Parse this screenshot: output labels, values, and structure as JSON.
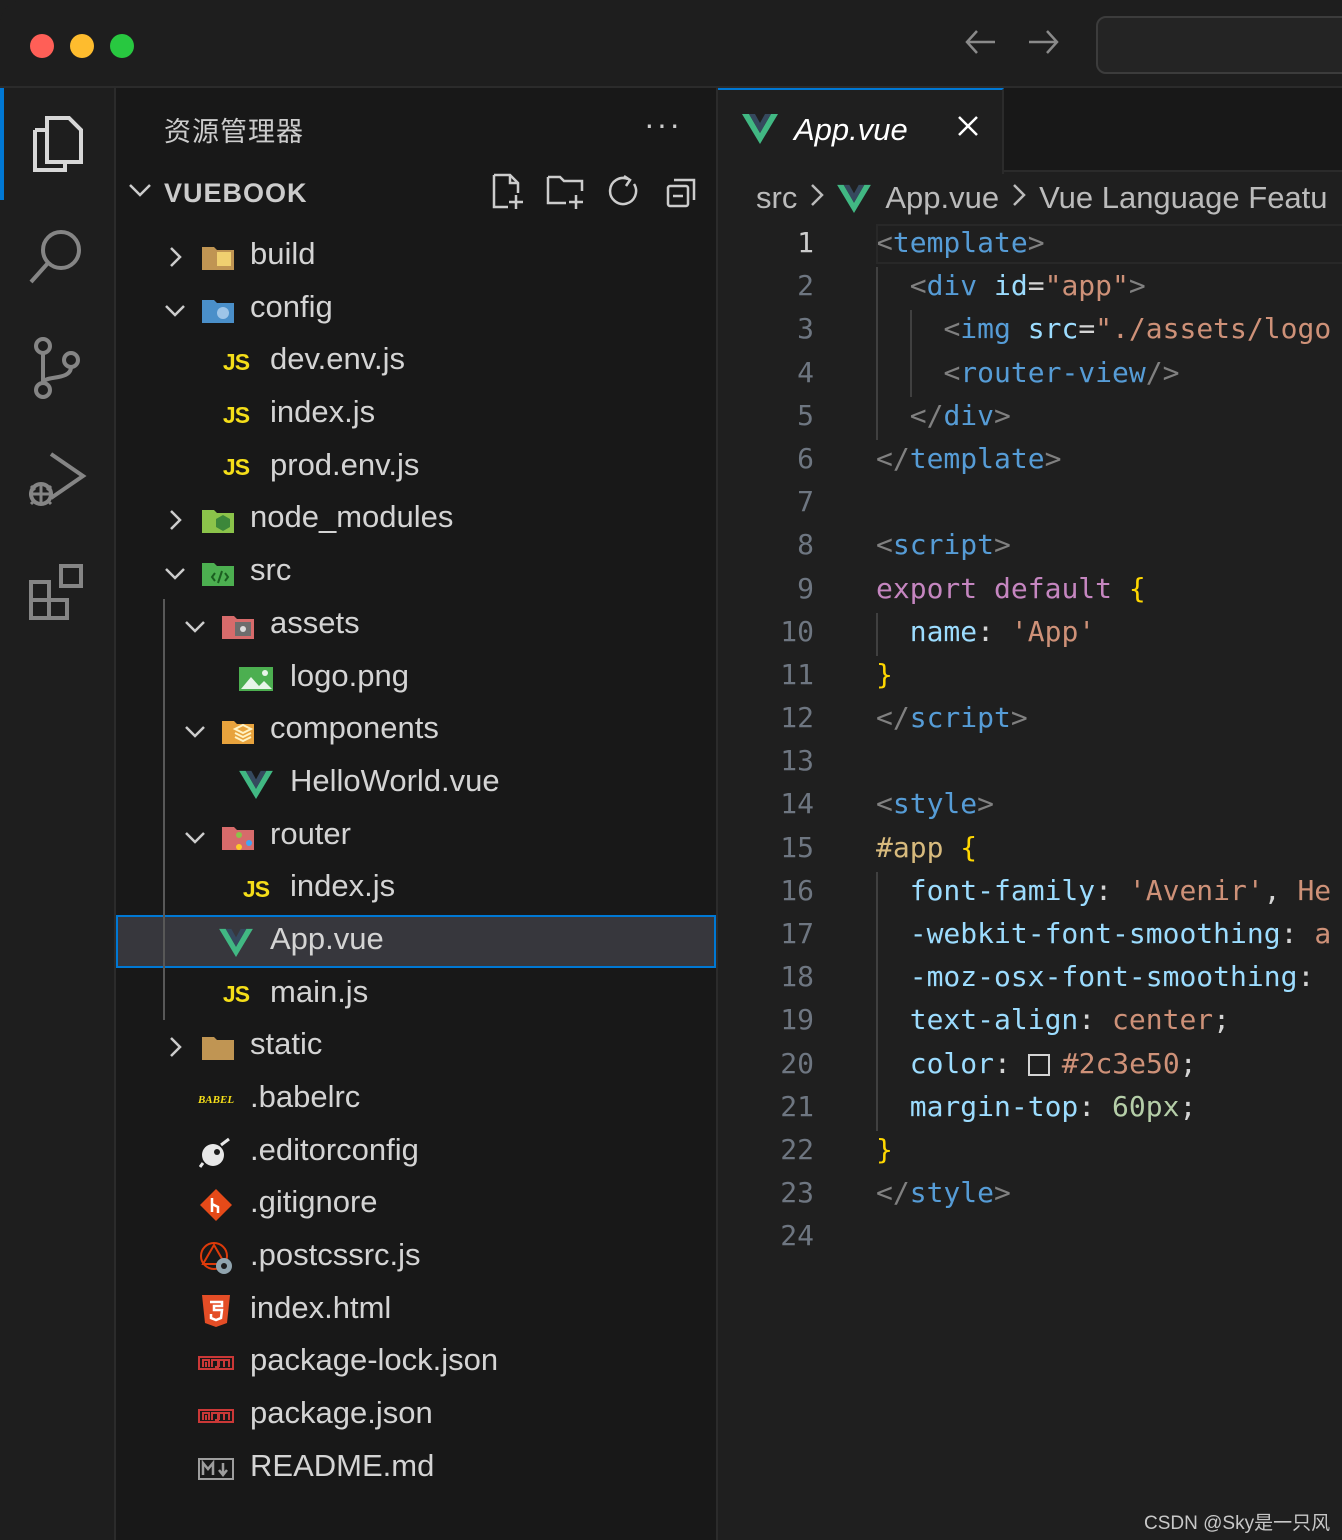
{
  "sidebar": {
    "title": "资源管理器",
    "more": "···",
    "section_title": "VUEBOOK"
  },
  "tree": [
    {
      "name": "build",
      "depth": 0,
      "type": "folder",
      "open": false,
      "icon": "folder-build-icon"
    },
    {
      "name": "config",
      "depth": 0,
      "type": "folder",
      "open": true,
      "icon": "folder-config-icon"
    },
    {
      "name": "dev.env.js",
      "depth": 1,
      "type": "js",
      "icon": "js-file-icon"
    },
    {
      "name": "index.js",
      "depth": 1,
      "type": "js",
      "icon": "js-file-icon"
    },
    {
      "name": "prod.env.js",
      "depth": 1,
      "type": "js",
      "icon": "js-file-icon"
    },
    {
      "name": "node_modules",
      "depth": 0,
      "type": "folder",
      "open": false,
      "icon": "folder-node-icon"
    },
    {
      "name": "src",
      "depth": 0,
      "type": "folder",
      "open": true,
      "icon": "folder-src-icon"
    },
    {
      "name": "assets",
      "depth": 1,
      "type": "folder",
      "open": true,
      "icon": "folder-assets-icon"
    },
    {
      "name": "logo.png",
      "depth": 2,
      "type": "image",
      "icon": "image-file-icon"
    },
    {
      "name": "components",
      "depth": 1,
      "type": "folder",
      "open": true,
      "icon": "folder-components-icon"
    },
    {
      "name": "HelloWorld.vue",
      "depth": 2,
      "type": "vue",
      "icon": "vue-file-icon"
    },
    {
      "name": "router",
      "depth": 1,
      "type": "folder",
      "open": true,
      "icon": "folder-router-icon"
    },
    {
      "name": "index.js",
      "depth": 2,
      "type": "js",
      "icon": "js-file-icon"
    },
    {
      "name": "App.vue",
      "depth": 1,
      "type": "vue",
      "selected": true,
      "icon": "vue-file-icon"
    },
    {
      "name": "main.js",
      "depth": 1,
      "type": "js",
      "icon": "js-file-icon"
    },
    {
      "name": "static",
      "depth": 0,
      "type": "folder",
      "open": false,
      "icon": "folder-icon"
    },
    {
      "name": ".babelrc",
      "depth": 0,
      "type": "babel",
      "icon": "babel-file-icon"
    },
    {
      "name": ".editorconfig",
      "depth": 0,
      "type": "editorconfig",
      "icon": "editorconfig-file-icon"
    },
    {
      "name": ".gitignore",
      "depth": 0,
      "type": "git",
      "icon": "git-file-icon"
    },
    {
      "name": ".postcssrc.js",
      "depth": 0,
      "type": "postcss",
      "icon": "postcss-file-icon"
    },
    {
      "name": "index.html",
      "depth": 0,
      "type": "html",
      "icon": "html-file-icon"
    },
    {
      "name": "package-lock.json",
      "depth": 0,
      "type": "npm",
      "icon": "npm-file-icon"
    },
    {
      "name": "package.json",
      "depth": 0,
      "type": "npm",
      "icon": "npm-file-icon"
    },
    {
      "name": "README.md",
      "depth": 0,
      "type": "md",
      "icon": "markdown-file-icon"
    }
  ],
  "editor": {
    "tab_label": "App.vue",
    "breadcrumb": [
      "src",
      "App.vue",
      "Vue Language Featu"
    ],
    "current_line": 1,
    "lines": [
      [
        [
          "t-punc",
          "<"
        ],
        [
          "t-tag",
          "template"
        ],
        [
          "t-punc",
          ">"
        ]
      ],
      [
        [
          "t-plain",
          "  "
        ],
        [
          "t-punc",
          "<"
        ],
        [
          "t-tag",
          "div"
        ],
        [
          "t-plain",
          " "
        ],
        [
          "t-attr",
          "id"
        ],
        [
          "t-plain",
          "="
        ],
        [
          "t-str",
          "\"app\""
        ],
        [
          "t-punc",
          ">"
        ]
      ],
      [
        [
          "t-plain",
          "    "
        ],
        [
          "t-punc",
          "<"
        ],
        [
          "t-tag",
          "img"
        ],
        [
          "t-plain",
          " "
        ],
        [
          "t-attr",
          "src"
        ],
        [
          "t-plain",
          "="
        ],
        [
          "t-str",
          "\"./assets/logo"
        ]
      ],
      [
        [
          "t-plain",
          "    "
        ],
        [
          "t-punc",
          "<"
        ],
        [
          "t-tag",
          "router-view"
        ],
        [
          "t-punc",
          "/>"
        ]
      ],
      [
        [
          "t-plain",
          "  "
        ],
        [
          "t-punc",
          "</"
        ],
        [
          "t-tag",
          "div"
        ],
        [
          "t-punc",
          ">"
        ]
      ],
      [
        [
          "t-punc",
          "</"
        ],
        [
          "t-tag",
          "template"
        ],
        [
          "t-punc",
          ">"
        ]
      ],
      [],
      [
        [
          "t-punc",
          "<"
        ],
        [
          "t-tag",
          "script"
        ],
        [
          "t-punc",
          ">"
        ]
      ],
      [
        [
          "t-kw",
          "export"
        ],
        [
          "t-plain",
          " "
        ],
        [
          "t-kw",
          "default"
        ],
        [
          "t-plain",
          " "
        ],
        [
          "t-brace",
          "{"
        ]
      ],
      [
        [
          "t-plain",
          "  "
        ],
        [
          "t-prop",
          "name"
        ],
        [
          "t-plain",
          ": "
        ],
        [
          "t-str",
          "'App'"
        ]
      ],
      [
        [
          "t-brace",
          "}"
        ]
      ],
      [
        [
          "t-punc",
          "</"
        ],
        [
          "t-tag",
          "script"
        ],
        [
          "t-punc",
          ">"
        ]
      ],
      [],
      [
        [
          "t-punc",
          "<"
        ],
        [
          "t-tag",
          "style"
        ],
        [
          "t-punc",
          ">"
        ]
      ],
      [
        [
          "t-sel",
          "#app"
        ],
        [
          "t-plain",
          " "
        ],
        [
          "t-brace",
          "{"
        ]
      ],
      [
        [
          "t-plain",
          "  "
        ],
        [
          "t-prop",
          "font-family"
        ],
        [
          "t-plain",
          ": "
        ],
        [
          "t-val",
          "'Avenir'"
        ],
        [
          "t-plain",
          ", "
        ],
        [
          "t-val",
          "He"
        ]
      ],
      [
        [
          "t-plain",
          "  "
        ],
        [
          "t-prop",
          "-webkit-font-smoothing"
        ],
        [
          "t-plain",
          ": "
        ],
        [
          "t-val",
          "a"
        ]
      ],
      [
        [
          "t-plain",
          "  "
        ],
        [
          "t-prop",
          "-moz-osx-font-smoothing"
        ],
        [
          "t-plain",
          ":"
        ]
      ],
      [
        [
          "t-plain",
          "  "
        ],
        [
          "t-prop",
          "text-align"
        ],
        [
          "t-plain",
          ": "
        ],
        [
          "t-val",
          "center"
        ],
        [
          "t-plain",
          ";"
        ]
      ],
      [
        [
          "t-plain",
          "  "
        ],
        [
          "t-prop",
          "color"
        ],
        [
          "t-plain",
          ": "
        ],
        [
          "swatch",
          ""
        ],
        [
          "t-val",
          "#2c3e50"
        ],
        [
          "t-plain",
          ";"
        ]
      ],
      [
        [
          "t-plain",
          "  "
        ],
        [
          "t-prop",
          "margin-top"
        ],
        [
          "t-plain",
          ": "
        ],
        [
          "t-num",
          "60px"
        ],
        [
          "t-plain",
          ";"
        ]
      ],
      [
        [
          "t-brace",
          "}"
        ]
      ],
      [
        [
          "t-punc",
          "</"
        ],
        [
          "t-tag",
          "style"
        ],
        [
          "t-punc",
          ">"
        ]
      ],
      []
    ]
  },
  "watermark": "CSDN @Sky是一只风",
  "colors": {
    "accent": "#0078d4",
    "js": "#f5de19",
    "vue_green": "#41b883",
    "vue_dark": "#35495e"
  }
}
